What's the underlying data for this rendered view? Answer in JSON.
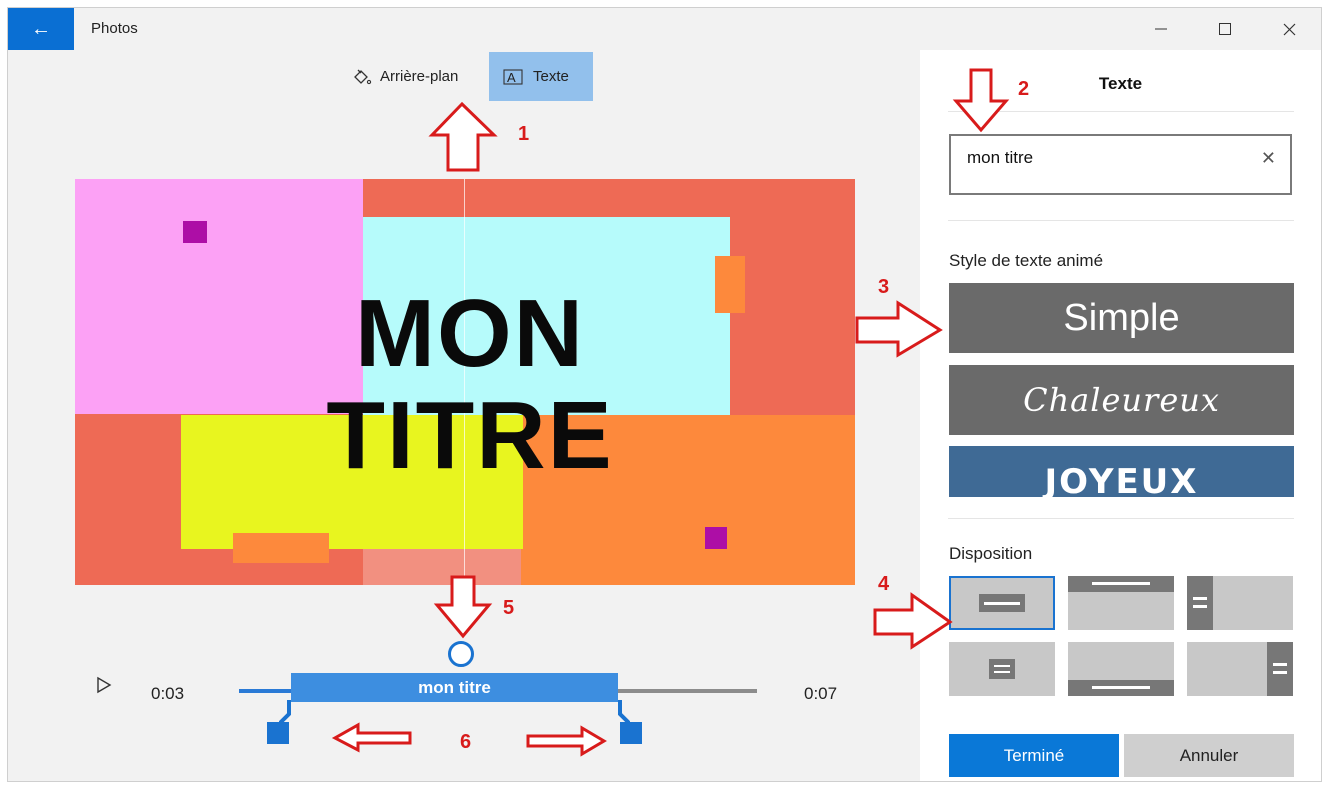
{
  "window": {
    "title": "Photos",
    "controls": {
      "minimize": "—",
      "maximize": "☐",
      "close": "✕"
    },
    "back_icon": "←"
  },
  "toolbar": {
    "background_label": "Arrière-plan",
    "text_label": "Texte",
    "active": "text"
  },
  "preview": {
    "title_line1": "MON",
    "title_line2": "TITRE"
  },
  "timeline": {
    "current_time": "0:03",
    "end_time": "0:07",
    "clip_label": "mon titre",
    "play_icon": "▷"
  },
  "panel": {
    "title": "Texte",
    "text_value": "mon titre",
    "clear_icon": "✕",
    "style_heading": "Style de texte animé",
    "styles": [
      "Simple",
      "Chaleureux",
      "JOYEUX"
    ],
    "layout_heading": "Disposition",
    "selected_layout": 0,
    "done_label": "Terminé",
    "cancel_label": "Annuler"
  },
  "annotations": [
    "1",
    "2",
    "3",
    "4",
    "5",
    "6"
  ],
  "colors": {
    "accent": "#0a6fd3",
    "annotation_red": "#d81b1b",
    "tile_gray": "#6a6a6a",
    "tile_blue": "#3f6a95"
  }
}
